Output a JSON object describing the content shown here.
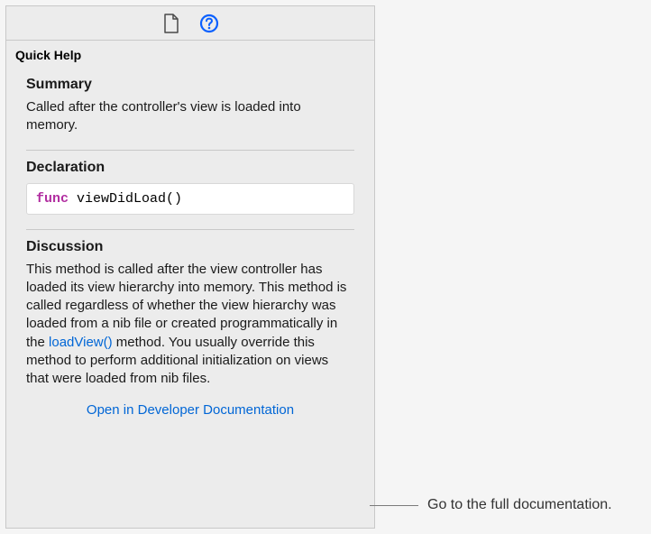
{
  "panel": {
    "title": "Quick Help"
  },
  "summary": {
    "heading": "Summary",
    "text": "Called after the controller's view is loaded into memory."
  },
  "declaration": {
    "heading": "Declaration",
    "keyword": "func",
    "signature": " viewDidLoad()"
  },
  "discussion": {
    "heading": "Discussion",
    "text_before": "This method is called after the view controller has loaded its view hierarchy into memory. This method is called regardless of whether the view hierarchy was loaded from a nib file or created programmatically in the ",
    "link_text": "loadView()",
    "text_after": " method. You usually override this method to perform additional initialization on views that were loaded from nib files."
  },
  "open_link": "Open in Developer Documentation",
  "callout": "Go to the full documentation."
}
